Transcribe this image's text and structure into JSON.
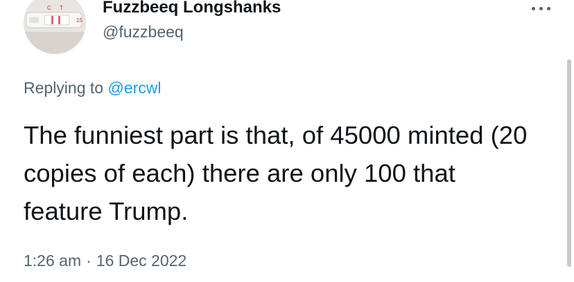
{
  "author": {
    "display_name": "Fuzzbeeq Longshanks",
    "handle": "@fuzzbeeq",
    "avatar_icon": "test-strip-photo",
    "avatar_text": {
      "c_label": "C",
      "t_label": "T",
      "number": "15"
    }
  },
  "more_menu": {
    "icon": "more-horizontal-icon"
  },
  "reply": {
    "prefix": "Replying to",
    "target": "@ercwl"
  },
  "tweet": {
    "text": "The funniest part is that, of 45000 minted (20 copies of each) there are only 100 that feature Trump."
  },
  "meta": {
    "time": "1:26 am",
    "separator": "·",
    "date": "16 Dec 2022"
  },
  "colors": {
    "text_primary": "#0f1419",
    "text_secondary": "#536471",
    "accent": "#1d9bf0"
  }
}
